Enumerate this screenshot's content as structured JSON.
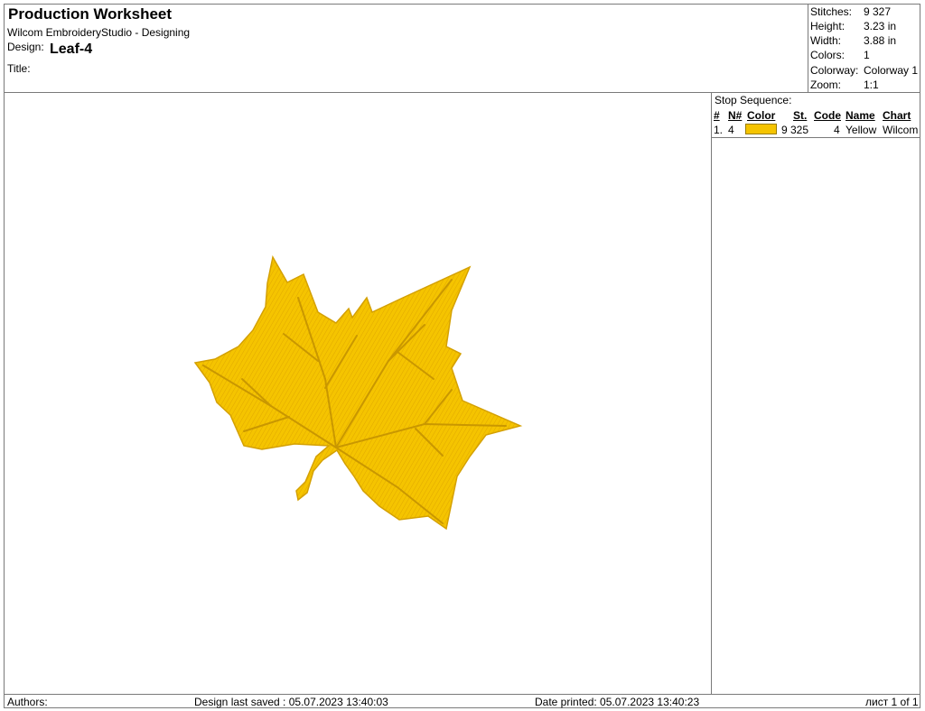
{
  "header": {
    "title": "Production Worksheet",
    "software": "Wilcom EmbroideryStudio - Designing",
    "design_label": "Design:",
    "design_name": "Leaf-4",
    "title_label": "Title:"
  },
  "info": {
    "stitches_label": "Stitches:",
    "stitches": "9 327",
    "height_label": "Height:",
    "height": "3.23 in",
    "width_label": "Width:",
    "width": "3.88 in",
    "colors_label": "Colors:",
    "colors": "1",
    "colorway_label": "Colorway:",
    "colorway": "Colorway 1",
    "zoom_label": "Zoom:",
    "zoom": "1:1"
  },
  "stop_sequence": {
    "title": "Stop Sequence:",
    "headers": {
      "num": "#",
      "n": "N#",
      "color": "Color",
      "st": "St.",
      "code": "Code",
      "name": "Name",
      "chart": "Chart"
    },
    "rows": [
      {
        "num": "1.",
        "n": "4",
        "color_hex": "#f5c400",
        "st": "9 325",
        "code": "4",
        "name": "Yellow",
        "chart": "Wilcom"
      }
    ]
  },
  "footer": {
    "authors": "Authors:",
    "saved": "Design last saved : 05.07.2023 13:40:03",
    "printed": "Date printed: 05.07.2023 13:40:23",
    "page": "лист 1 of 1"
  },
  "design_preview": {
    "icon": "maple-leaf-embroidery",
    "thread_color": "#f5c400"
  }
}
